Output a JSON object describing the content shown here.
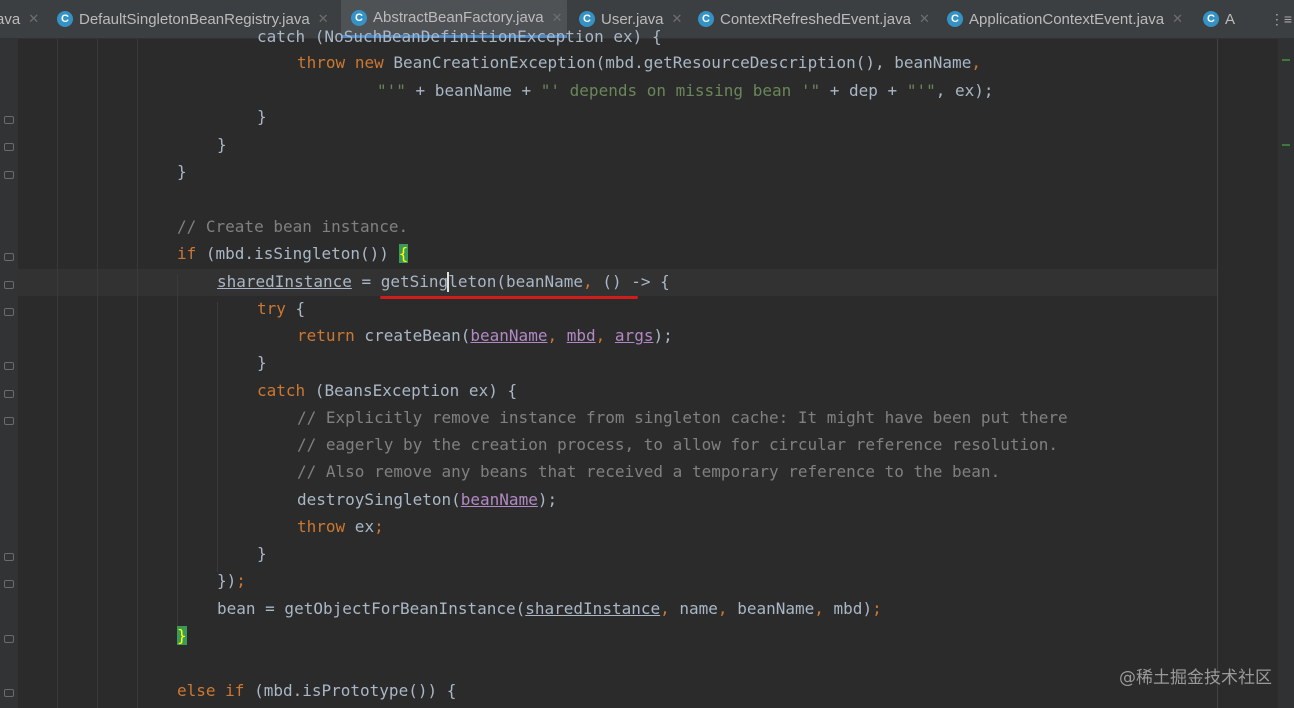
{
  "tabs": [
    {
      "label": "ava",
      "icon": "java-file-icon"
    },
    {
      "label": "DefaultSingletonBeanRegistry.java",
      "icon": "java-class-icon"
    },
    {
      "label": "AbstractBeanFactory.java",
      "icon": "java-class-icon",
      "active": true
    },
    {
      "label": "User.java",
      "icon": "java-class-icon"
    },
    {
      "label": "ContextRefreshedEvent.java",
      "icon": "java-class-icon"
    },
    {
      "label": "ApplicationContextEvent.java",
      "icon": "java-class-icon"
    },
    {
      "label": "A",
      "icon": "java-class-icon"
    }
  ],
  "tab_icon_glyph": "C",
  "tab_close_glyph": "✕",
  "tab_menu_glyph": "⋮≡",
  "code": {
    "line0": {
      "t1": "catch (NoSuchBeanDefinitionException ex) {"
    },
    "line1": {
      "k1": "throw",
      "k2": "new",
      "t1": " BeanCreationException(mbd.getResourceDescription(), beanName",
      "t2": ","
    },
    "line2": {
      "s1": "\"'\"",
      "t1": " + beanName + ",
      "s2": "\"' depends on missing bean '\"",
      "t2": " + dep + ",
      "s3": "\"'\"",
      "t3": ", ex);"
    },
    "line3": {
      "t1": "}"
    },
    "line4": {
      "t1": "}"
    },
    "line5": {
      "t1": "}"
    },
    "line7": {
      "c1": "// Create bean instance."
    },
    "line8": {
      "k1": "if",
      "t1": " (mbd.isSingleton()) ",
      "b1": "{"
    },
    "line9": {
      "f1": "sharedInstance",
      "t1": " = getSingleton(beanName",
      "t2": ",",
      "t3": " () -> {"
    },
    "line10": {
      "k1": "try",
      "t1": " {"
    },
    "line11": {
      "k1": "return",
      "t1": " createBean(",
      "p1": "beanName",
      "t2": ",",
      "t3": " ",
      "p2": "mbd",
      "t4": ",",
      "t5": " ",
      "p3": "args",
      "t6": ");"
    },
    "line12": {
      "t1": "}"
    },
    "line13": {
      "k1": "catch",
      "t1": " (BeansException ex) {"
    },
    "line14": {
      "c1": "// Explicitly remove instance from singleton cache: It might have been put there"
    },
    "line15": {
      "c1": "// eagerly by the creation process, to allow for circular reference resolution."
    },
    "line16": {
      "c1": "// Also remove any beans that received a temporary reference to the bean."
    },
    "line17": {
      "t1": "destroySingleton(",
      "p1": "beanName",
      "t2": ");"
    },
    "line18": {
      "k1": "throw",
      "t1": " ex",
      "t2": ";"
    },
    "line19": {
      "t1": "}"
    },
    "line20": {
      "t1": "})",
      "t2": ";"
    },
    "line21": {
      "t1": "bean = getObjectForBeanInstance(",
      "f1": "sharedInstance",
      "t2": ",",
      "t3": " name",
      "t4": ",",
      "t5": " beanName",
      "t6": ",",
      "t7": " mbd)",
      "t8": ";"
    },
    "line22": {
      "b1": "}"
    },
    "line24": {
      "k1": "else",
      "k2": "if",
      "t1": " (mbd.isPrototype()) {"
    }
  },
  "watermark": "@稀土掘金技术社区",
  "colors": {
    "background": "#2b2b2b",
    "keyword": "#cc7832",
    "string": "#6a8759",
    "comment": "#808080",
    "parameter": "#b389c5",
    "brace_match": "#3b9a57",
    "annotation_underline": "#d21b1b",
    "active_tab_accent": "#4a88c7"
  }
}
